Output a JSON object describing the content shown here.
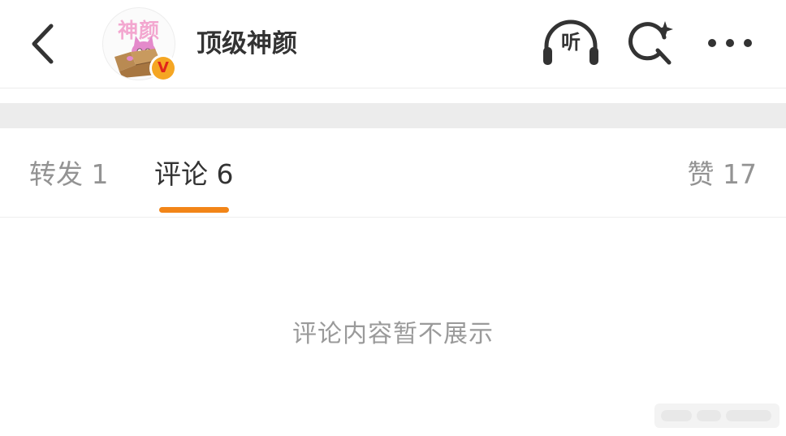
{
  "header": {
    "back_icon": "chevron-left-icon",
    "avatar_text": "神颜",
    "verified_mark": "V",
    "account_name": "顶级神颜",
    "listen_label": "听",
    "search_icon": "search-sparkle-icon",
    "more_icon": "more-dots-icon"
  },
  "tabs": [
    {
      "label": "转发 1",
      "active": false
    },
    {
      "label": "评论 6",
      "active": true
    },
    {
      "label": "赞 17",
      "active": false
    }
  ],
  "empty_state": {
    "message": "评论内容暂不展示"
  },
  "colors": {
    "accent_underline": "#f28518",
    "verified_badge": "#f5a623",
    "active_tab_text": "#333333",
    "inactive_tab_text": "#939393",
    "band_gray": "#ececec"
  }
}
